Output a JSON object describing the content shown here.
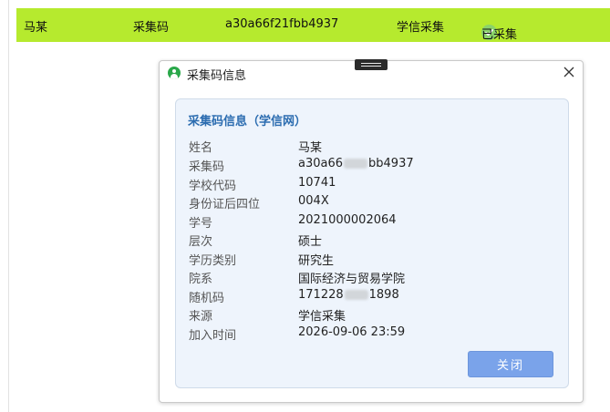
{
  "record": {
    "name": "马某",
    "code_label": "采集码",
    "code_value": "a30a66f21fbb4937",
    "source": "学信采集",
    "status": "已采集"
  },
  "dialog": {
    "title": "采集码信息",
    "panel_title": "采集码信息（学信网）",
    "fields": [
      {
        "label": "姓名",
        "value": "马某"
      },
      {
        "label": "采集码",
        "value_prefix": "a30a66",
        "value_suffix": "bb4937"
      },
      {
        "label": "学校代码",
        "value": "10741"
      },
      {
        "label": "身份证后四位",
        "value": "004X"
      },
      {
        "label": "学号",
        "value": "2021000002064"
      },
      {
        "label": "层次",
        "value": "硕士"
      },
      {
        "label": "学历类别",
        "value": "研究生"
      },
      {
        "label": "院系",
        "value": "国际经济与贸易学院"
      },
      {
        "label": "随机码",
        "value_prefix": "171228",
        "value_suffix": "1898"
      },
      {
        "label": "来源",
        "value": "学信采集"
      },
      {
        "label": "加入时间",
        "value": "2026-09-06 23:59"
      }
    ],
    "close_button": "关闭"
  },
  "colors": {
    "row_highlight": "#b6ea2e",
    "panel_background": "#eef4fc",
    "panel_title": "#2b6cb0",
    "button_primary": "#7aa3ea",
    "status_check": "#8bd36a"
  },
  "icons": {
    "title": "user-icon",
    "close": "close-icon",
    "status": "check-circle-icon"
  }
}
